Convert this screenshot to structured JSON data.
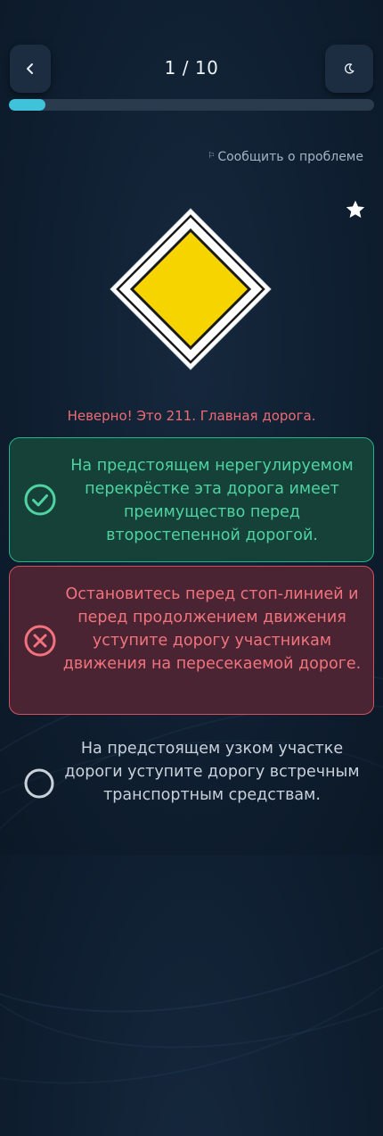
{
  "header": {
    "counter": "1 / 10",
    "back_icon": "chevron-left-icon",
    "theme_icon": "moon-icon"
  },
  "progress": {
    "current": 1,
    "total": 10,
    "fraction": 0.1,
    "color": "#3fc3db"
  },
  "report_link": {
    "icon": "flag-icon",
    "label": "Сообщить о проблеме"
  },
  "favorite": {
    "icon": "star-icon"
  },
  "sign": {
    "name": "main-road-sign",
    "fill_color": "#f5d400",
    "border_color": "#ffffff"
  },
  "feedback": {
    "text": "Неверно! Это 211. Главная дорога.",
    "color": "#ef6b73"
  },
  "answers": [
    {
      "state": "correct",
      "icon": "check-circle-icon",
      "text": "На предстоящем нерегулируемом перекрёстке эта дорога имеет преимущество перед второстепенной дорогой."
    },
    {
      "state": "wrong",
      "icon": "x-circle-icon",
      "text": "Остановитесь перед стоп-линией и перед продолжением движения уступите дорогу участникам движения на пересекаемой дороге."
    },
    {
      "state": "neutral",
      "icon": "empty-circle-icon",
      "text": "На предстоящем узком участке дороги уступите дорогу встречным транспортным средствам."
    }
  ]
}
